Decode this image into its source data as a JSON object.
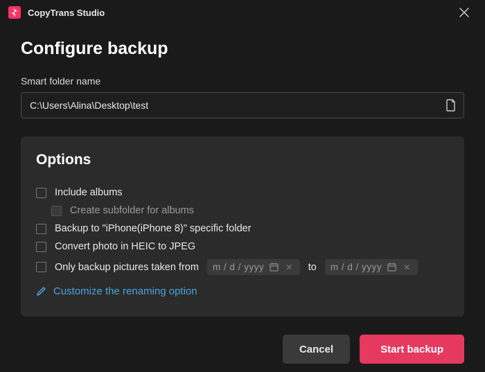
{
  "app": {
    "title": "CopyTrans Studio"
  },
  "page": {
    "heading": "Configure backup",
    "folder_label": "Smart folder name",
    "folder_path": "C:\\Users\\Alina\\Desktop\\test"
  },
  "options": {
    "title": "Options",
    "include_albums": "Include albums",
    "create_subfolder": "Create subfolder for albums",
    "backup_specific": "Backup to \"iPhone(iPhone 8)\" specific folder",
    "convert_heic": "Convert photo in HEIC to JPEG",
    "only_pictures_from": "Only backup pictures taken from",
    "to_word": "to",
    "date_placeholder": "m / d / yyyy",
    "customize_link": "Customize the renaming option"
  },
  "buttons": {
    "cancel": "Cancel",
    "start": "Start backup"
  }
}
